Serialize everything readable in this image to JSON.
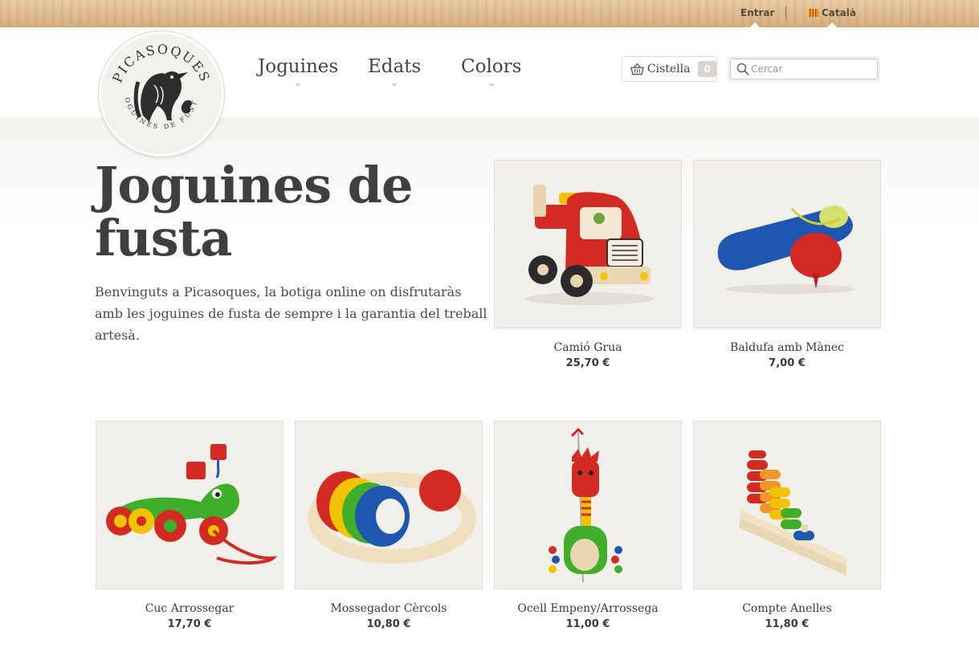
{
  "topbar": {
    "login": "Entrar",
    "language": "Català"
  },
  "logo": {
    "brand": "PICASOQUES",
    "tagline": "JOGUINES DE FUSTA"
  },
  "nav": {
    "items": [
      {
        "label": "Joguines"
      },
      {
        "label": "Edats"
      },
      {
        "label": "Colors"
      }
    ]
  },
  "cart": {
    "label": "Cistella",
    "count": "0"
  },
  "search": {
    "placeholder": "Cercar"
  },
  "hero": {
    "title_line1": "Joguines de",
    "title_line2": "fusta",
    "text": "Benvinguts a Picasoques, la botiga online on disfrutaràs amb les joguines de fusta de sempre i la garantia del treball artesà."
  },
  "products": [
    {
      "name": "Camió Grua",
      "price": "25,70 €",
      "icon": "toy-truck-icon"
    },
    {
      "name": "Baldufa amb Mànec",
      "price": "7,00 €",
      "icon": "spinning-top-icon"
    },
    {
      "name": "Cuc Arrossegar",
      "price": "17,70 €",
      "icon": "caterpillar-toy-icon"
    },
    {
      "name": "Mossegador Cèrcols",
      "price": "10,80 €",
      "icon": "teether-rings-icon"
    },
    {
      "name": "Ocell Empeny/Arrossega",
      "price": "11,00 €",
      "icon": "bird-push-toy-icon"
    },
    {
      "name": "Compte Anelles",
      "price": "11,80 €",
      "icon": "ring-counter-icon"
    }
  ],
  "colors": {
    "wood": "#ddb98c",
    "text": "#444444",
    "toy_red": "#d42a24",
    "toy_blue": "#1f56b0",
    "toy_green": "#3fae2a",
    "toy_yellow": "#f2c300"
  }
}
